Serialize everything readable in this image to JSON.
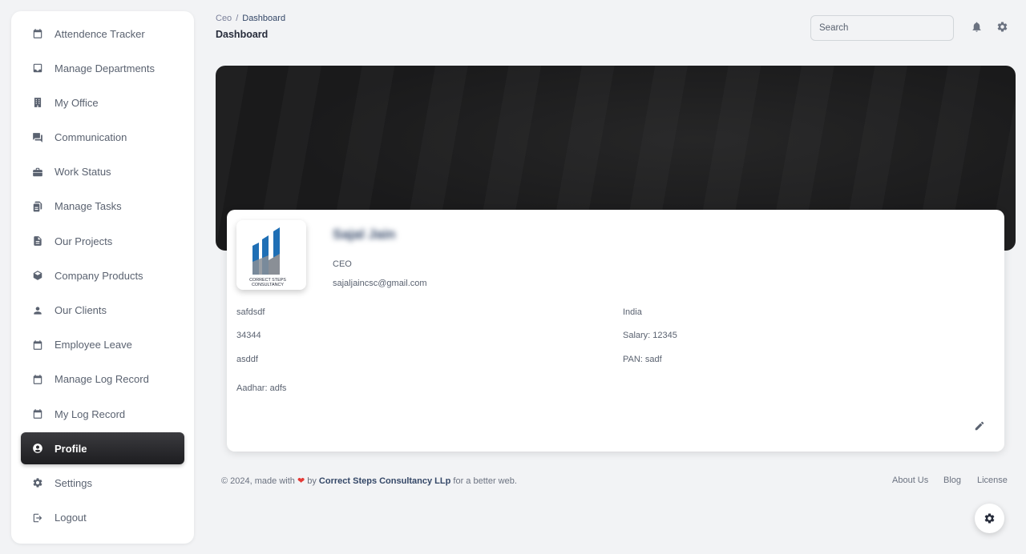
{
  "sidebar": {
    "items": [
      {
        "label": "Attendence Tracker",
        "icon": "calendar-icon"
      },
      {
        "label": "Manage Departments",
        "icon": "inbox-icon"
      },
      {
        "label": "My Office",
        "icon": "building-icon"
      },
      {
        "label": "Communication",
        "icon": "forum-icon"
      },
      {
        "label": "Work Status",
        "icon": "briefcase-icon"
      },
      {
        "label": "Manage Tasks",
        "icon": "tasks-icon"
      },
      {
        "label": "Our Projects",
        "icon": "document-icon"
      },
      {
        "label": "Company Products",
        "icon": "box-icon"
      },
      {
        "label": "Our Clients",
        "icon": "person-icon"
      },
      {
        "label": "Employee Leave",
        "icon": "calendar-icon"
      },
      {
        "label": "Manage Log Record",
        "icon": "calendar-icon"
      },
      {
        "label": "My Log Record",
        "icon": "calendar-icon"
      },
      {
        "label": "Profile",
        "icon": "account-circle-icon",
        "active": true
      },
      {
        "label": "Settings",
        "icon": "gear-icon"
      },
      {
        "label": "Logout",
        "icon": "logout-icon"
      }
    ]
  },
  "header": {
    "breadcrumb_root": "Ceo",
    "breadcrumb_separator": "/",
    "breadcrumb_current": "Dashboard",
    "title": "Dashboard",
    "search_placeholder": "Search"
  },
  "profile": {
    "name": "Sajal Jain",
    "role": "CEO",
    "email": "sajaljaincsc@gmail.com",
    "logo_text_line1": "CORRECT STEPS",
    "logo_text_line2": "CONSULTANCY",
    "left_fields": [
      "safdsdf",
      "34344",
      "asddf",
      "Aadhar: adfs"
    ],
    "right_fields": [
      "India",
      "Salary: 12345",
      "PAN: sadf"
    ]
  },
  "footer": {
    "prefix": "© 2024, made with",
    "heart": "❤",
    "by": "by",
    "brand": "Correct Steps Consultancy LLp",
    "suffix": "for a better web.",
    "links": [
      "About Us",
      "Blog",
      "License"
    ]
  },
  "colors": {
    "active_nav": "#262b3a",
    "banner": "#1b1b1c",
    "logo_blue": "#1f6fb5",
    "logo_gray": "#8a8f96",
    "heart": "#e53935"
  }
}
